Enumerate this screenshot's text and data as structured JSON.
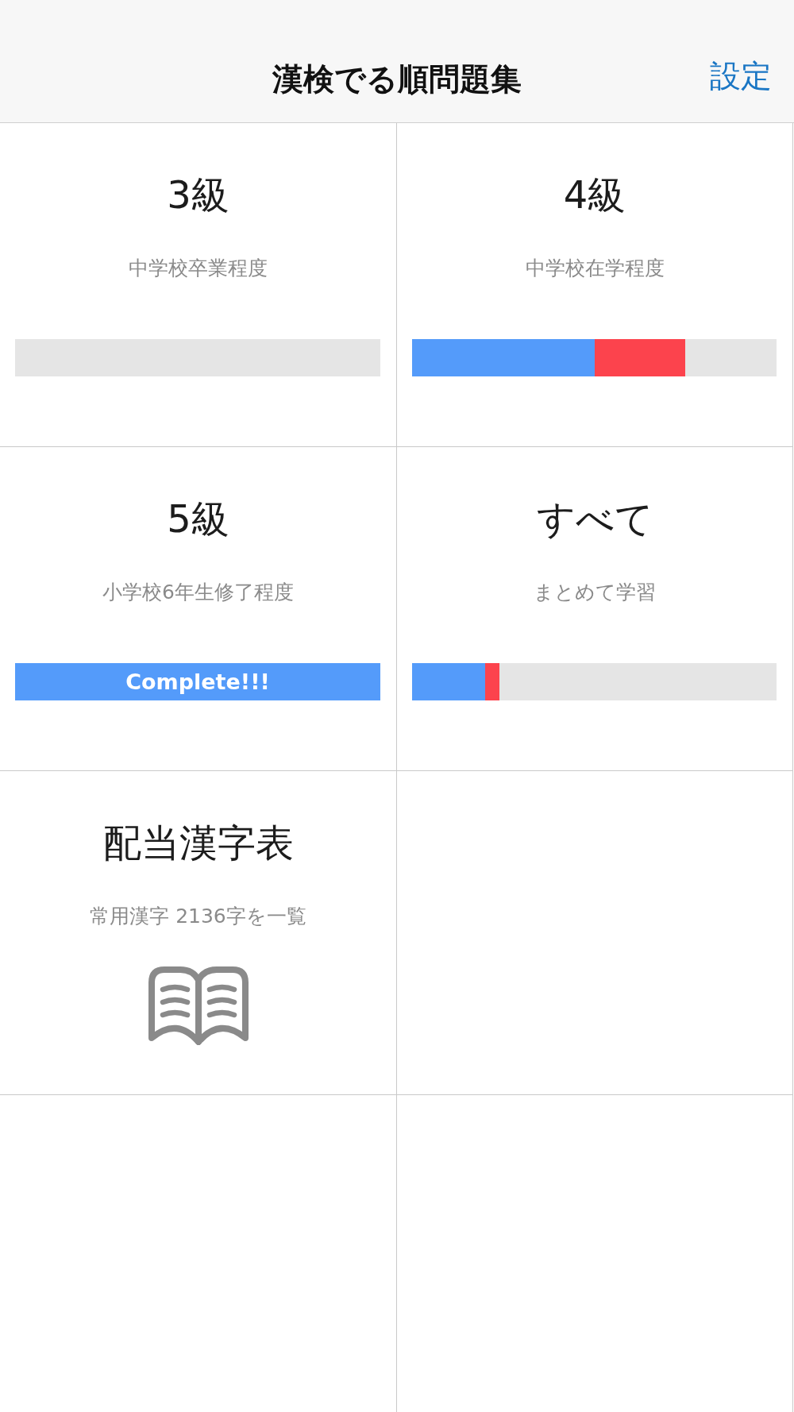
{
  "nav": {
    "title": "漢検でる順問題集",
    "settings": "設定"
  },
  "cells": [
    {
      "kind": "progress",
      "title": "3級",
      "subtitle": "中学校卒業程度",
      "progress": {
        "complete": false
      }
    },
    {
      "kind": "progress",
      "title": "4級",
      "subtitle": "中学校在学程度",
      "progress": {
        "complete": false,
        "fills": [
          {
            "level": 0.75,
            "color": "#fc434d"
          },
          {
            "level": 0.5,
            "color": "#549bfa"
          }
        ]
      }
    },
    {
      "kind": "progress",
      "title": "5級",
      "subtitle": "小学校6年生修了程度",
      "progress": {
        "complete": true,
        "label": "Complete!!!"
      }
    },
    {
      "kind": "progress",
      "title": "すべて",
      "subtitle": "まとめて学習",
      "progress": {
        "complete": false,
        "fills": [
          {
            "level": 0.24,
            "color": "#fc434d"
          },
          {
            "level": 0.2,
            "color": "#549bfa"
          }
        ]
      }
    },
    {
      "kind": "book",
      "title": "配当漢字表",
      "subtitle": "常用漢字 2136字を一覧"
    },
    {
      "kind": "empty"
    },
    {
      "kind": "empty"
    },
    {
      "kind": "empty"
    }
  ]
}
